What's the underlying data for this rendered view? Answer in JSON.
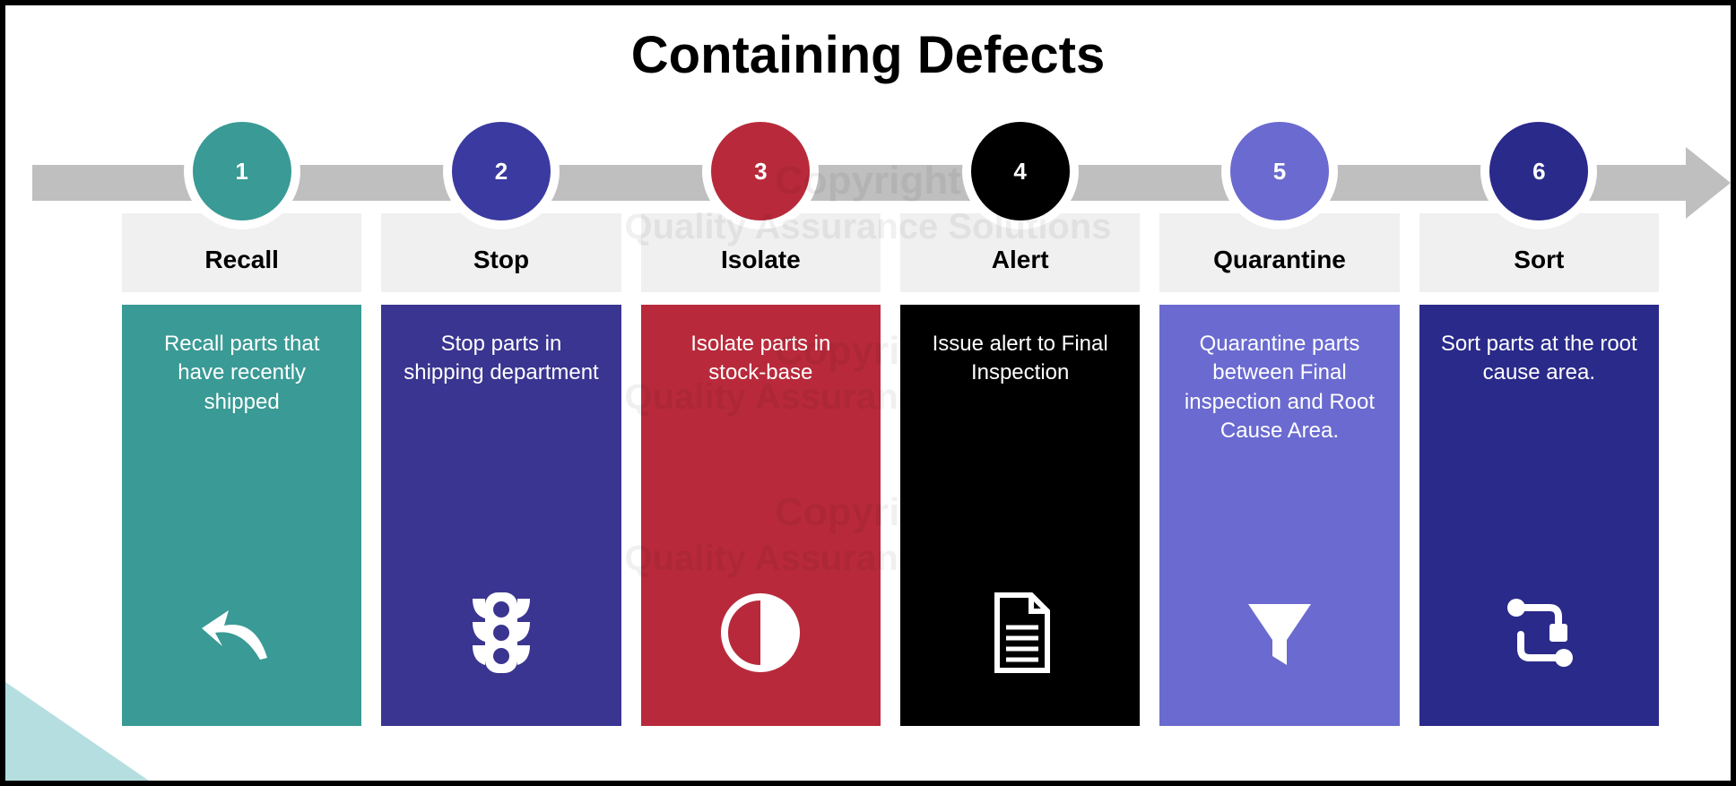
{
  "title": "Containing Defects",
  "watermark": {
    "line1": "Copyright",
    "line2": "Quality Assurance Solutions"
  },
  "steps": [
    {
      "num": "1",
      "label": "Recall",
      "desc": "Recall parts that have recently shipped",
      "color": "#3a9a95",
      "descColor": "#3a9a95",
      "icon": "arrow-back-icon"
    },
    {
      "num": "2",
      "label": "Stop",
      "desc": "Stop parts in shipping department",
      "color": "#3a3aa0",
      "descColor": "#3a3590",
      "icon": "traffic-light-icon"
    },
    {
      "num": "3",
      "label": "Isolate",
      "desc": "Isolate parts in stock-base",
      "color": "#b82a3b",
      "descColor": "#b82a3b",
      "icon": "half-circle-icon"
    },
    {
      "num": "4",
      "label": "Alert",
      "desc": "Issue alert to Final Inspection",
      "color": "#000000",
      "descColor": "#000000",
      "icon": "document-icon"
    },
    {
      "num": "5",
      "label": "Quarantine",
      "desc": "Quarantine parts between Final inspection and Root Cause Area.",
      "color": "#6a6ad0",
      "descColor": "#6a6ad0",
      "icon": "funnel-icon"
    },
    {
      "num": "6",
      "label": "Sort",
      "desc": "Sort parts at the root cause area.",
      "color": "#2a2a8a",
      "descColor": "#2a2a8a",
      "icon": "branch-icon"
    }
  ]
}
